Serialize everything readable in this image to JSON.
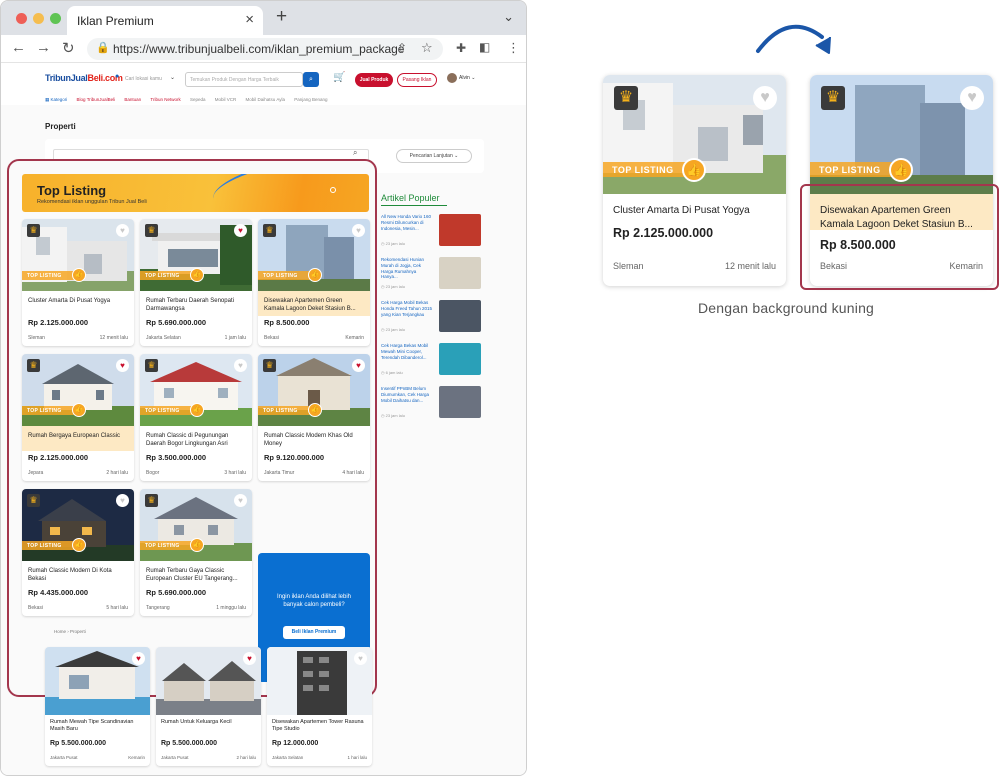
{
  "browser": {
    "tab_title": "Iklan Premium",
    "url": "https://www.tribunjualbeli.com/iklan_premium_package",
    "close_glyph": "×",
    "newtab_glyph": "+"
  },
  "header": {
    "logo_main": "TribunJual",
    "logo_accent": "Beli.com",
    "location_placeholder": "Cari lokasi kamu",
    "search_placeholder": "Temukan Produk Dengan Harga Terbaik",
    "sell_button": "Jual Produk",
    "post_button": "Pasang Iklan",
    "user_name": "Alvin",
    "category_label": "Kategori",
    "subnav": [
      "Blog TribunJualBeli",
      "Bantuan",
      "Tribun Network"
    ],
    "subnav_more": [
      "Sepeda",
      "Mobil VCR",
      "Mobil Daihatsu Ayla",
      "Panjang Benang"
    ]
  },
  "page": {
    "title": "Properti",
    "advanced_search": "Pencarian Lanjutan"
  },
  "top_listing": {
    "title": "Top Listing",
    "subtitle": "Rekomendasi iklan unggulan Tribun Jual Beli",
    "badge": "TOP LISTING",
    "cards": [
      {
        "title": "Cluster Amarta Di Pusat Yogya",
        "price": "Rp 2.125.000.000",
        "location": "Sleman",
        "time": "12 menit lalu",
        "highlight": false,
        "liked": false
      },
      {
        "title": "Rumah Terbaru Daerah Senopati Darmawangsa",
        "price": "Rp 5.690.000.000",
        "location": "Jakarta Selatan",
        "time": "1 jam lalu",
        "highlight": false,
        "liked": true
      },
      {
        "title": "Disewakan Apartemen Green Kamala Lagoon Deket Stasiun B...",
        "price": "Rp 8.500.000",
        "location": "Bekasi",
        "time": "Kemarin",
        "highlight": true,
        "liked": false
      },
      {
        "title": "Rumah Bergaya European Classic",
        "price": "Rp 2.125.000.000",
        "location": "Jepara",
        "time": "2 hari lalu",
        "highlight": true,
        "liked": true
      },
      {
        "title": "Rumah Classic di Pegunungan Daerah Bogor Lingkungan Asri",
        "price": "Rp 3.500.000.000",
        "location": "Bogor",
        "time": "3 hari lalu",
        "highlight": false,
        "liked": false
      },
      {
        "title": "Rumah Classic Modern Khas Old Money",
        "price": "Rp 9.120.000.000",
        "location": "Jakarta Timur",
        "time": "4 hari lalu",
        "highlight": false,
        "liked": true
      },
      {
        "title": "Rumah Classic Modern Di Kota Bekasi",
        "price": "Rp 4.435.000.000",
        "location": "Bekasi",
        "time": "5 hari lalu",
        "highlight": false,
        "liked": false
      },
      {
        "title": "Rumah Terbaru Gaya Classic European Cluster EU Tangerang...",
        "price": "Rp 5.690.000.000",
        "location": "Tangerang",
        "time": "1 minggu lalu",
        "highlight": false,
        "liked": false
      }
    ],
    "promo_text": "Ingin iklan Anda dilihat lebih banyak calon pembeli?",
    "promo_button": "Beli Iklan Premium"
  },
  "artikel": {
    "title": "Artikel Populer",
    "items": [
      {
        "title": "All New Honda Vario 160 Resmi Diluncurkan di Indonesia, Mesin...",
        "date": "23 jam lalu"
      },
      {
        "title": "Rekomendasi Hunian Murah di Jogja, Cek Harga Rumahnya Hanya...",
        "date": "23 jam lalu"
      },
      {
        "title": "Cek Harga Mobil Bekas Honda Freed Tahun 2015 yang Kian Terjangkau",
        "date": "23 jam lalu"
      },
      {
        "title": "Cek Harga Bekas Mobil Mewah Mini Cooper, Terendah Dibanderol...",
        "date": "6 jam lalu"
      },
      {
        "title": "Insentif PPnBM Belum Diumumkan, Cek Harga Mobil Daihatsu dan...",
        "date": "23 jam lalu"
      }
    ]
  },
  "breadcrumb": {
    "home": "Home",
    "current": "Properti"
  },
  "lower_listings": [
    {
      "title": "Rumah Mewah Tipe Scandinavian Masih Baru",
      "price": "Rp 5.500.000.000",
      "location": "Jakarta Pusat",
      "time": "Kemarin",
      "liked": true
    },
    {
      "title": "Rumah Untuk Keluarga Kecil",
      "price": "Rp 5.500.000.000",
      "location": "Jakarta Pusat",
      "time": "2 hari lalu",
      "liked": true
    },
    {
      "title": "Disewakan Apartemen Tower Rasuna Tipe Studio",
      "price": "Rp 12.000.000",
      "location": "Jakarta Selatan",
      "time": "1 hari lalu",
      "liked": false
    }
  ],
  "showcase": {
    "badge": "TOP LISTING",
    "before": {
      "title": "Cluster Amarta Di Pusat Yogya",
      "price": "Rp 2.125.000.000",
      "location": "Sleman",
      "time": "12 menit lalu"
    },
    "after": {
      "title": "Disewakan Apartemen Green Kamala Lagoon Deket Stasiun B...",
      "price": "Rp 8.500.000",
      "location": "Bekasi",
      "time": "Kemarin"
    },
    "caption": "Dengan background kuning"
  },
  "colors": {
    "accent": "#a3364d",
    "highlight": "#fde9c4",
    "badge": "#f6a623",
    "promo": "#0a6fd1",
    "brand": "#c8102e"
  }
}
